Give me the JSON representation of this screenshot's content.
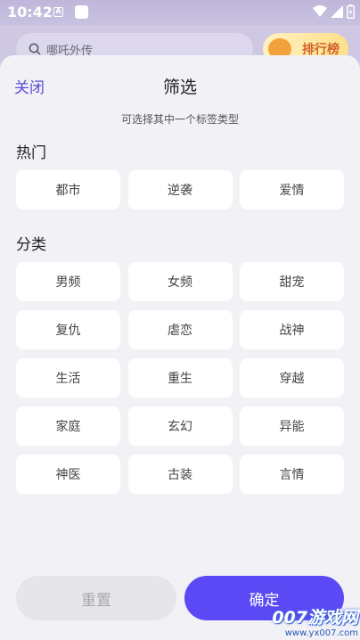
{
  "status_bar": {
    "time": "10:42",
    "notif_letter": "A",
    "icons": [
      "wifi-icon",
      "signal-icon",
      "battery-icon"
    ]
  },
  "backdrop": {
    "search_placeholder": "哪吒外传",
    "rank_label": "排行榜"
  },
  "sheet": {
    "close_label": "关闭",
    "title": "筛选",
    "hint": "可选择其中一个标签类型",
    "sections": [
      {
        "label": "热门",
        "tags": [
          "都市",
          "逆袭",
          "爱情"
        ]
      },
      {
        "label": "分类",
        "tags": [
          "男频",
          "女频",
          "甜宠",
          "复仇",
          "虐恋",
          "战神",
          "生活",
          "重生",
          "穿越",
          "家庭",
          "玄幻",
          "异能",
          "神医",
          "古装",
          "言情"
        ]
      }
    ],
    "reset_label": "重置",
    "confirm_label": "确定"
  },
  "watermark": {
    "main": "007游戏网",
    "url": "www.yx007.com"
  },
  "colors": {
    "accent": "#5b49f5",
    "close": "#5a4bd6",
    "sheet_bg": "#f2f2f6"
  }
}
